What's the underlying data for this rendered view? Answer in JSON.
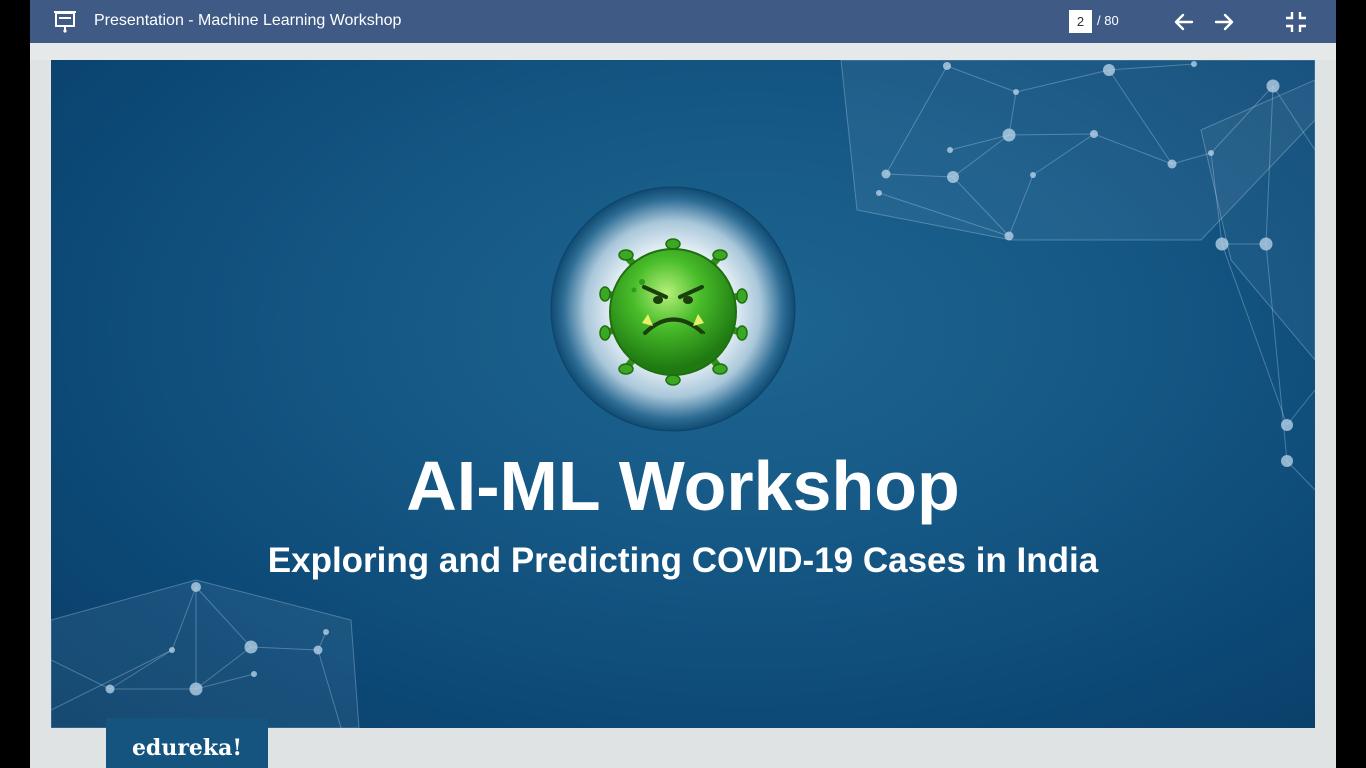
{
  "toolbar": {
    "title": "Presentation - Machine Learning Workshop",
    "current_page": "2",
    "total_pages": "/ 80",
    "icons": [
      "presentation-icon",
      "arrow-left-icon",
      "arrow-right-icon",
      "exit-fullscreen-icon"
    ]
  },
  "slide": {
    "title": "AI-ML Workshop",
    "subtitle": "Exploring and Predicting COVID-19 Cases in India",
    "image": "virus-illustration"
  },
  "logo": {
    "text": "edureka!"
  },
  "colors": {
    "toolbar": "#3f5a85",
    "slide_background": "#155784",
    "frame": "#dfe3e3",
    "logo_background": "#15547f",
    "virus_green": "#3fae22"
  }
}
